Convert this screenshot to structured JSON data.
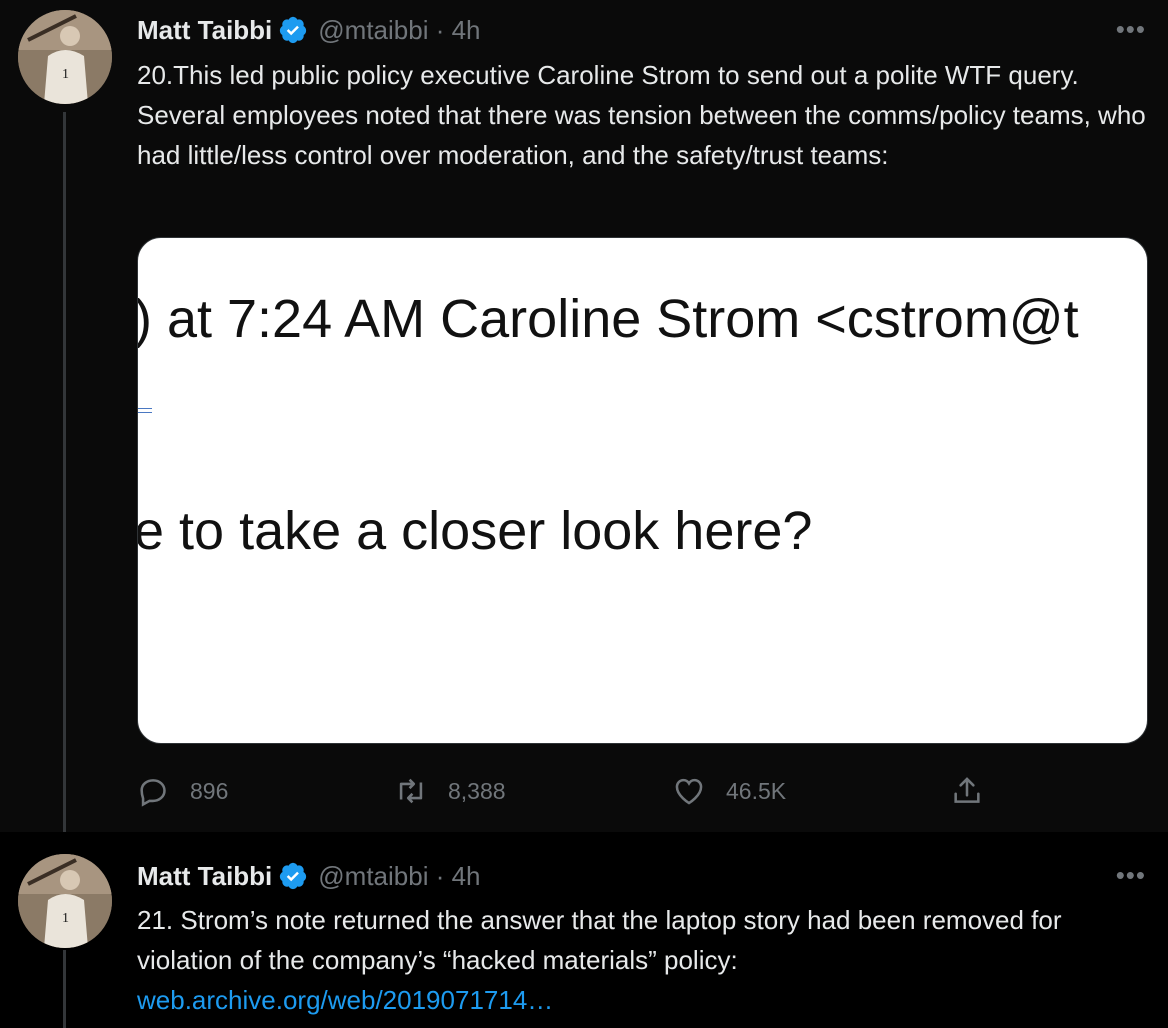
{
  "tweets": [
    {
      "author": "Matt Taibbi",
      "handle_time": "@mtaibbi · 4h",
      "more": "•••",
      "text": "20.This led public policy executive Caroline Strom to send out a polite WTF query. Several employees noted that there was tension between the comms/policy teams, who had little/less control over moderation, and the safety/trust teams:",
      "media": {
        "line1": ") at 7:24 AM Caroline Strom <cstrom@t",
        "line2": "e to take a closer look here?"
      },
      "actions": {
        "replies": "896",
        "retweets": "8,388",
        "likes": "46.5K"
      }
    },
    {
      "author": "Matt Taibbi",
      "handle_time": "@mtaibbi · 4h",
      "more": "•••",
      "text": "21. Strom’s note returned the answer that the laptop story had been removed for violation of the company’s “hacked materials” policy:",
      "link": "web.archive.org/web/2019071714…"
    }
  ],
  "colors": {
    "verified": "#1d9bf0",
    "link": "#1d9bf0",
    "muted": "#71767b"
  },
  "icons": [
    "verified-badge-icon",
    "more-icon",
    "reply-icon",
    "retweet-icon",
    "like-icon",
    "share-icon"
  ]
}
